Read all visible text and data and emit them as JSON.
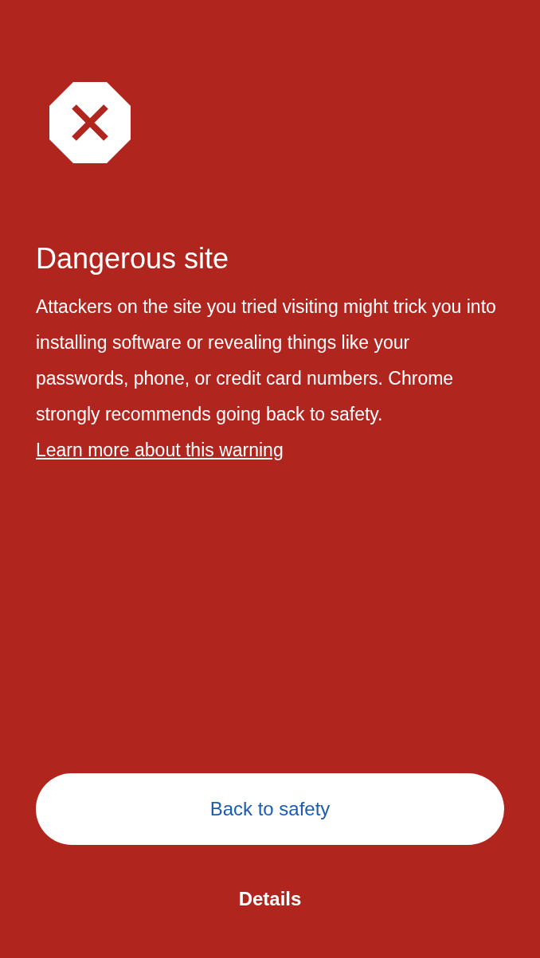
{
  "title": "Dangerous site",
  "body": "Attackers on the site you tried visiting might trick you into installing software or revealing things like your passwords, phone, or credit card numbers. Chrome strongly recommends going back to safety.",
  "link": "Learn more about this warning",
  "primary_button": "Back to safety",
  "secondary_button": "Details"
}
